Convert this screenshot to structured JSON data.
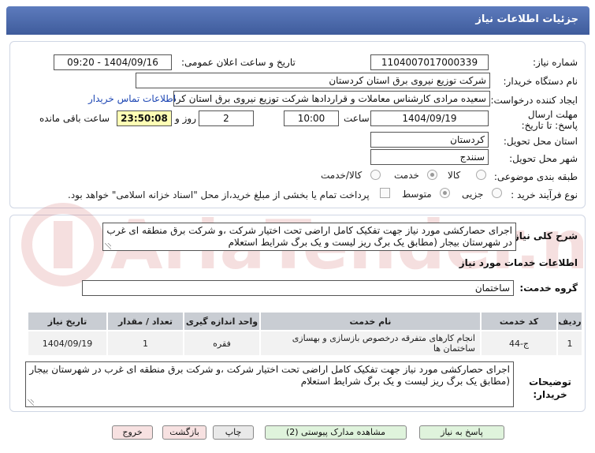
{
  "header": {
    "title": "جزئیات اطلاعات نیاز"
  },
  "fields": {
    "need_number_label": "شماره نیاز:",
    "need_number": "1104007017000339",
    "announce_label": "تاریخ و ساعت اعلان عمومی:",
    "announce_value": "1404/09/16 - 09:20",
    "buyer_org_label": "نام دستگاه خریدار:",
    "buyer_org": "شرکت توزیع نیروی برق استان کردستان",
    "creator_label": "ایجاد کننده درخواست:",
    "creator": "سعیده مرادی کارشناس معاملات و قراردادها شرکت توزیع نیروی برق استان کردستان",
    "buyer_contact_link": "اطلاعات تماس خریدار",
    "deadline_label": "مهلت ارسال پاسخ: تا تاریخ:",
    "deadline_date": "1404/09/19",
    "time_label": "ساعت",
    "deadline_time": "10:00",
    "days_value": "2",
    "days_label": "روز و",
    "remaining_time": "23:50:08",
    "remaining_label": "ساعت باقی مانده",
    "province_label": "استان محل تحویل:",
    "province": "کردستان",
    "city_label": "شهر محل تحویل:",
    "city": "سنندج",
    "category_label": "طبقه بندی موضوعی:",
    "category_options": [
      "کالا",
      "خدمت",
      "کالا/خدمت"
    ],
    "category_selected": "خدمت",
    "process_label": "نوع فرآیند خرید :",
    "process_options": [
      "جزیی",
      "متوسط"
    ],
    "process_selected": "متوسط",
    "payment_note": "پرداخت تمام یا بخشی از مبلغ خرید،از محل \"اسناد خزانه اسلامی\" خواهد بود."
  },
  "description": {
    "label": "شرح کلی نیاز:",
    "text": "اجرای حصارکشی  مورد نیاز جهت تفکیک کامل اراضی تحت اختیار شرکت ،و شرکت برق منطقه ای غرب در شهرستان بیجار (مطابق یک برگ ریز لیست و یک برگ شرایط استعلام"
  },
  "services": {
    "section_title": "اطلاعات خدمات مورد نیاز",
    "group_label": "گروه خدمت:",
    "group_value": "ساختمان",
    "columns": [
      "ردیف",
      "کد خدمت",
      "نام خدمت",
      "واحد اندازه گیری",
      "تعداد / مقدار",
      "تاریخ نیاز"
    ],
    "rows": [
      [
        "1",
        "ج-44",
        "انجام کارهای متفرقه درخصوص بازسازی و بهسازی ساختمان ها",
        "فقره",
        "1",
        "1404/09/19"
      ]
    ]
  },
  "buyer_notes": {
    "label": "توضیحات خریدار:",
    "text": "اجرای حصارکشی  مورد نیاز جهت تفکیک کامل اراضی تحت اختیار شرکت ،و شرکت برق منطقه ای غرب در شهرستان بیجار (مطابق یک برگ ریز لیست و یک برگ شرایط استعلام"
  },
  "buttons": {
    "reply": "پاسخ به نیاز",
    "attachments": "مشاهده مدارک پیوستی (2)",
    "print": "چاپ",
    "back": "بازگشت",
    "exit": "خروج"
  },
  "watermark": {
    "text": "AriaTender.neT"
  }
}
